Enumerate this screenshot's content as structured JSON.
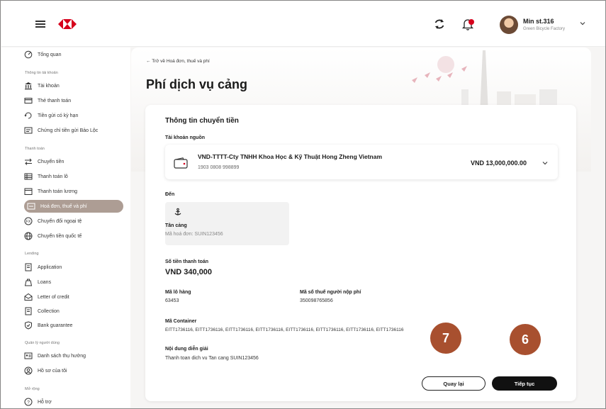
{
  "header": {
    "user_name": "Min st.316",
    "user_company": "Green Bicycle Factory"
  },
  "sidebar": {
    "items": [
      {
        "label": "Tổng quan",
        "icon": "overview-icon"
      },
      {
        "label": "Thông tin tài khoản",
        "section": true
      },
      {
        "label": "Tài khoản",
        "icon": "bank-icon"
      },
      {
        "label": "Thẻ thanh toán",
        "icon": "card-icon"
      },
      {
        "label": "Tiền gửi có kỳ hạn",
        "icon": "deposit-icon"
      },
      {
        "label": "Chứng chỉ tiền gửi Bảo Lộc",
        "icon": "certificate-icon"
      },
      {
        "label": "Thanh toán",
        "section": true
      },
      {
        "label": "Chuyển tiền",
        "icon": "transfer-icon"
      },
      {
        "label": "Thanh toán lô",
        "icon": "batch-icon"
      },
      {
        "label": "Thanh toán lương",
        "icon": "payroll-icon"
      },
      {
        "label": "Hoá đơn, thuế và phí",
        "icon": "invoice-icon",
        "active": true
      },
      {
        "label": "Chuyển đổi ngoại tệ",
        "icon": "fx-icon"
      },
      {
        "label": "Chuyển tiền quốc tế",
        "icon": "globe-icon"
      },
      {
        "label": "Lending",
        "section": true
      },
      {
        "label": "Application",
        "icon": "application-icon"
      },
      {
        "label": "Loans",
        "icon": "loans-icon"
      },
      {
        "label": "Letter of credit",
        "icon": "letter-icon"
      },
      {
        "label": "Collection",
        "icon": "collection-icon"
      },
      {
        "label": "Bank guarantee",
        "icon": "shield-icon"
      },
      {
        "label": "Quản lý người dùng",
        "section": true
      },
      {
        "label": "Danh sách thụ hưởng",
        "icon": "beneficiary-icon"
      },
      {
        "label": "Hồ sơ của tôi",
        "icon": "profile-icon"
      },
      {
        "label": "Mở rộng",
        "section": true
      },
      {
        "label": "Hỗ trợ",
        "icon": "help-icon"
      }
    ]
  },
  "page": {
    "back_link": "← Trở về Hoá đơn, thuế và phí",
    "title": "Phí dịch vụ cảng"
  },
  "form": {
    "section_title": "Thông tin chuyển tiền",
    "source_label": "Tài khoản nguồn",
    "account_name": "VND-TTTT-Cty TNHH Khoa Học & Kỹ Thuật Hong Zheng Vietnam",
    "account_number": "1903 0808 998899",
    "account_balance": "VND 13,000,000.00",
    "dest_label": "Đến",
    "dest_name": "Tân cảng",
    "dest_code": "Mã hoá đơn: SUIN123456",
    "amount_label": "Số tiền thanh toán",
    "amount_value": "VND 340,000",
    "lot_label": "Mã lô hàng",
    "lot_value": "63453",
    "tax_label": "Mã số thuế người nộp phí",
    "tax_value": "350098765856",
    "container_label": "Mã Container",
    "container_value": "EITT1736116, EITT1736116, EITT1736116, EITT1736116, EITT1736116, EITT1736116, EITT1736116, EITT1736116",
    "desc_label": "Nội dung diễn giải",
    "desc_value": "Thanh toan dich vu Tan cang SUIN123456"
  },
  "buttons": {
    "back": "Quay lại",
    "next": "Tiếp tục"
  },
  "markers": {
    "seven": "7",
    "six": "6"
  },
  "colors": {
    "brand_red": "#d6001c",
    "active_nav": "#ad9d94",
    "marker": "#a8502f",
    "primary_button": "#111111"
  }
}
